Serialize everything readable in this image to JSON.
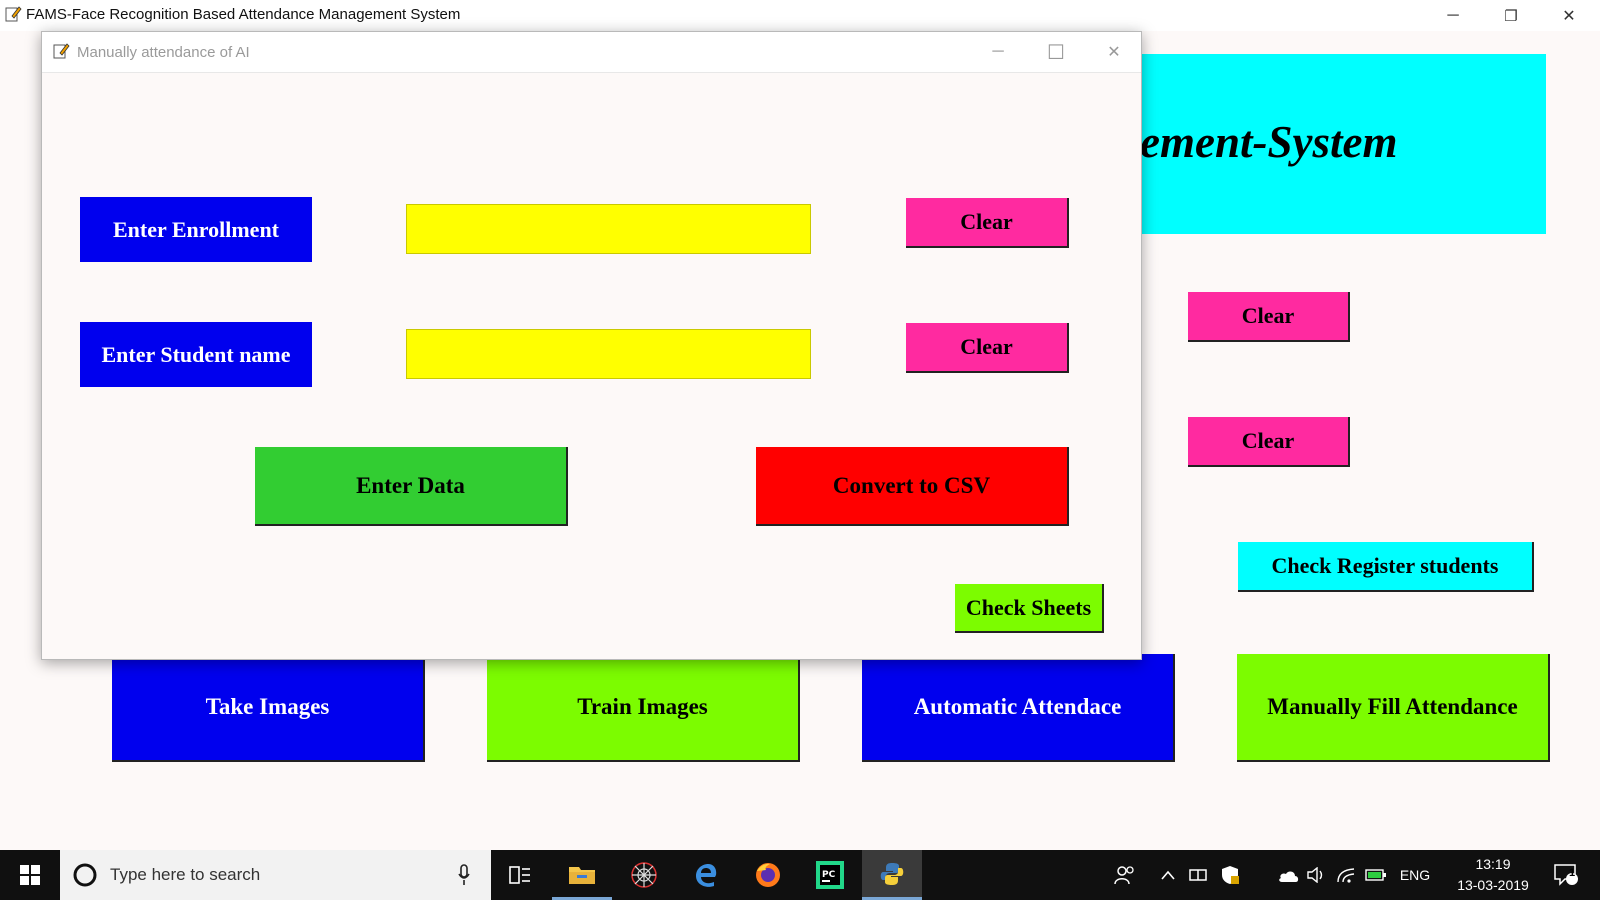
{
  "main_window": {
    "title": "FAMS-Face Recognition Based Attendance Management System",
    "header_text": "ement-System",
    "clear_buttons": [
      "Clear",
      "Clear"
    ],
    "check_register_label": "Check Register students",
    "bottom_buttons": [
      "Take Images",
      "Train Images",
      "Automatic Attendace",
      "Manually Fill Attendance"
    ],
    "controls": {
      "minimize": "─",
      "restore": "❐",
      "close": "✕"
    }
  },
  "dialog": {
    "title": "Manually attendance of AI",
    "enrollment_label": "Enter Enrollment",
    "enrollment_value": "",
    "student_name_label": "Enter Student name",
    "student_name_value": "",
    "clear_buttons": [
      "Clear",
      "Clear"
    ],
    "enter_data_label": "Enter Data",
    "convert_csv_label": "Convert to CSV",
    "check_sheets_label": "Check Sheets",
    "controls": {
      "minimize": "─",
      "maximize": "☐",
      "close": "✕"
    }
  },
  "taskbar": {
    "search_placeholder": "Type here to search",
    "language": "ENG",
    "time": "13:19",
    "date": "13-03-2019",
    "notification_count": "1"
  },
  "colors": {
    "blue": "#0000ee",
    "magenta": "#ff2aa0",
    "cyan": "#00ffff",
    "lime": "#7cfc00",
    "green": "#32cd32",
    "red": "#ff0000",
    "yellow": "#ffff00"
  }
}
